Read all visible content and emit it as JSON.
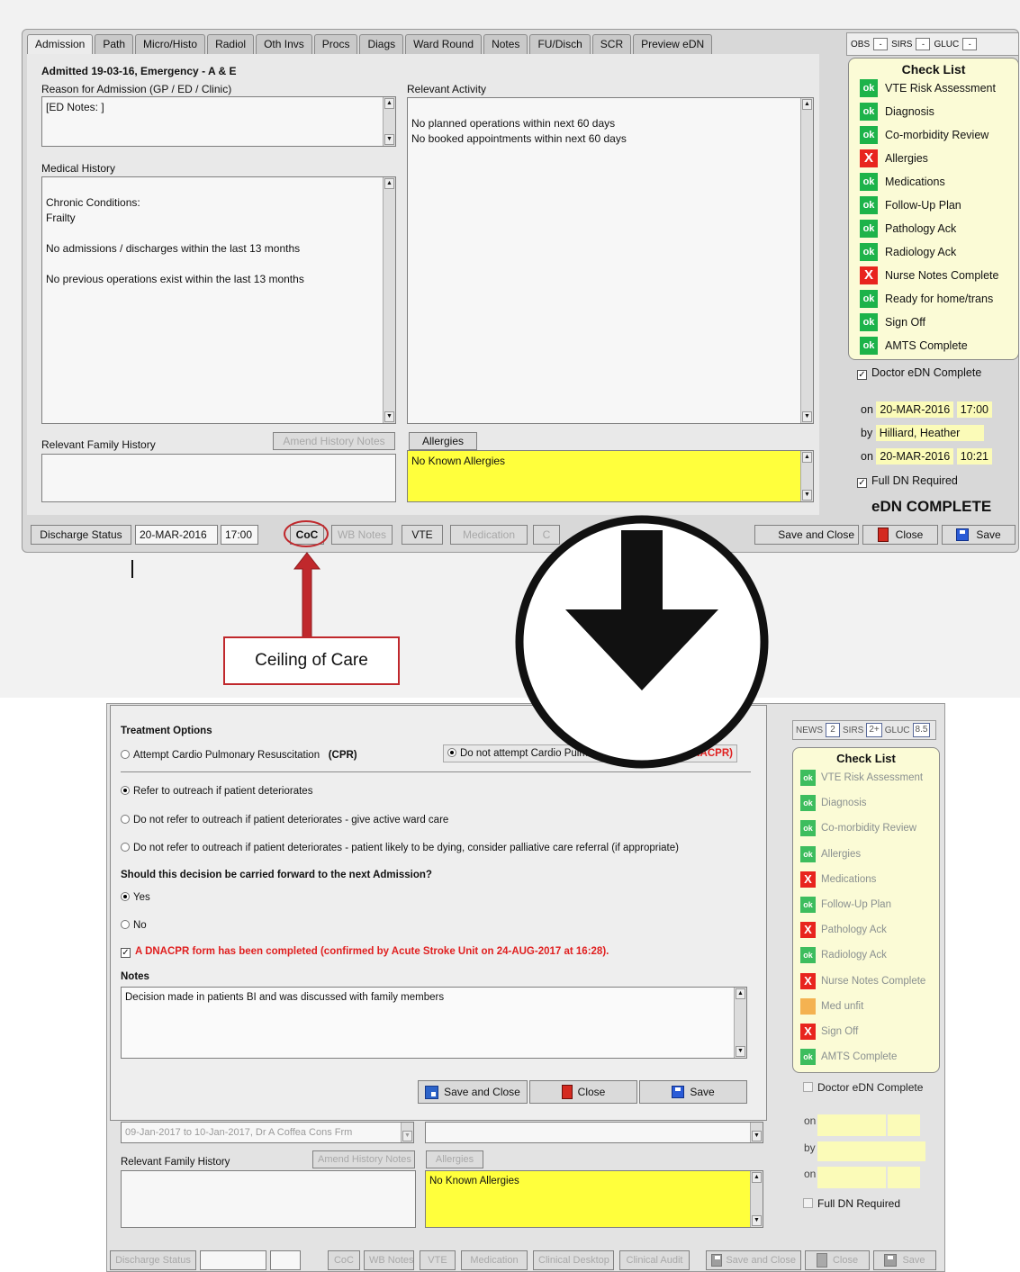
{
  "top": {
    "tabs": [
      "Admission",
      "Path",
      "Micro/Histo",
      "Radiol",
      "Oth Invs",
      "Procs",
      "Diags",
      "Ward Round",
      "Notes",
      "FU/Disch",
      "SCR",
      "Preview eDN"
    ],
    "metrics": {
      "obs": "OBS",
      "sirs": "SIRS",
      "gluc": "GLUC",
      "drop": "-"
    },
    "admitted": "Admitted 19-03-16, Emergency - A & E",
    "reason_label": "Reason for Admission (GP / ED / Clinic)",
    "reason_value": "[ED Notes: ]",
    "relevant_activity_label": "Relevant Activity",
    "relevant_activity": "No planned operations within next 60 days\nNo booked appointments within next 60 days",
    "medical_history_label": "Medical History",
    "medical_history": "Chronic Conditions:\n    Frailty\n\nNo admissions / discharges within the last 13 months\n\nNo previous operations exist within the last 13 months",
    "family_history_label": "Relevant Family History",
    "amend_history_notes": "Amend History Notes",
    "allergies_button": "Allergies",
    "allergies_value": "No Known Allergies",
    "checklist": {
      "title": "Check List",
      "items": [
        {
          "badge": "ok",
          "label": "VTE Risk Assessment"
        },
        {
          "badge": "ok",
          "label": "Diagnosis"
        },
        {
          "badge": "ok",
          "label": "Co-morbidity Review"
        },
        {
          "badge": "X",
          "label": "Allergies"
        },
        {
          "badge": "ok",
          "label": "Medications"
        },
        {
          "badge": "ok",
          "label": "Follow-Up Plan"
        },
        {
          "badge": "ok",
          "label": "Pathology Ack"
        },
        {
          "badge": "ok",
          "label": "Radiology Ack"
        },
        {
          "badge": "X",
          "label": "Nurse Notes Complete"
        },
        {
          "badge": "ok",
          "label": "Ready for home/trans"
        },
        {
          "badge": "ok",
          "label": "Sign Off"
        },
        {
          "badge": "ok",
          "label": "AMTS Complete"
        }
      ]
    },
    "doctor_edn_complete": "Doctor eDN Complete",
    "on_label": "on",
    "by_label": "by",
    "on1_date": "20-MAR-2016",
    "on1_time": "17:00",
    "by_name": "Hilliard, Heather",
    "on2_date": "20-MAR-2016",
    "on2_time": "10:21",
    "full_dn_required": "Full DN Required",
    "edn_complete": "eDN COMPLETE",
    "bottom_bar": {
      "discharge_status": "Discharge Status",
      "date": "20-MAR-2016",
      "time": "17:00",
      "coc": "CoC",
      "wb_notes": "WB Notes",
      "vte": "VTE",
      "medication": "Medication",
      "c": "C",
      "save_and_close": "Save and Close",
      "close": "Close",
      "save": "Save"
    }
  },
  "callout": {
    "text": "Ceiling of Care"
  },
  "bottom": {
    "treatment_options": "Treatment Options",
    "cpr_option": "Attempt Cardio Pulmonary Resuscitation",
    "cpr_abbr": "(CPR)",
    "dnacpr_option": "Do not attempt Cardio Pulmonary Resuscitation",
    "dnacpr_abbr": "(DNACPR)",
    "outreach_1": "Refer to outreach if patient deteriorates",
    "outreach_2": "Do not refer to outreach if patient deteriorates - give active ward care",
    "outreach_3": "Do not refer to outreach if patient deteriorates - patient likely to be dying, consider palliative care referral (if appropriate)",
    "carry_forward_q": "Should this decision be carried forward to the next Admission?",
    "yes": "Yes",
    "no": "No",
    "dnacpr_form": "A DNACPR form has been completed (confirmed by Acute Stroke Unit on 24-AUG-2017 at 16:28).",
    "notes_label": "Notes",
    "notes_value": "Decision made in patients BI and was discussed with family members",
    "save_and_close": "Save and Close",
    "close": "Close",
    "save": "Save",
    "metrics": {
      "news": "NEWS",
      "news_val": "2",
      "sirs": "SIRS",
      "sirs_val": "2+",
      "gluc": "GLUC",
      "gluc_val": "8.5"
    },
    "behind_text": "09-Jan-2017 to 10-Jan-2017, Dr A Coffea Cons Frm",
    "family_history_label": "Relevant Family History",
    "amend_history_notes": "Amend History Notes",
    "allergies_button": "Allergies",
    "allergies_value": "No Known Allergies",
    "checklist": {
      "title": "Check List",
      "items": [
        {
          "badge": "ok",
          "label": "VTE Risk Assessment"
        },
        {
          "badge": "ok",
          "label": "Diagnosis"
        },
        {
          "badge": "ok",
          "label": "Co-morbidity Review"
        },
        {
          "badge": "ok",
          "label": "Allergies"
        },
        {
          "badge": "X",
          "label": "Medications"
        },
        {
          "badge": "ok",
          "label": "Follow-Up Plan"
        },
        {
          "badge": "X",
          "label": "Pathology Ack"
        },
        {
          "badge": "ok",
          "label": "Radiology Ack"
        },
        {
          "badge": "X",
          "label": "Nurse Notes Complete"
        },
        {
          "badge": "amber",
          "label": "Med unfit"
        },
        {
          "badge": "X",
          "label": "Sign Off"
        },
        {
          "badge": "ok",
          "label": "AMTS Complete"
        }
      ]
    },
    "doctor_edn_complete": "Doctor eDN Complete",
    "on_label": "on",
    "by_label": "by",
    "full_dn_required": "Full DN Required",
    "bottom_bar": {
      "discharge_status": "Discharge Status",
      "coc": "CoC",
      "wb_notes": "WB Notes",
      "vte": "VTE",
      "medication": "Medication",
      "clinical_desktop": "Clinical Desktop",
      "clinical_audit": "Clinical Audit",
      "save_and_close": "Save and Close",
      "close": "Close",
      "save": "Save"
    }
  },
  "colors": {
    "ok": "#1db34a",
    "x": "#e8241e",
    "amber": "#f2a53a",
    "highlight": "#ffff3c",
    "callout": "#c0282c"
  }
}
